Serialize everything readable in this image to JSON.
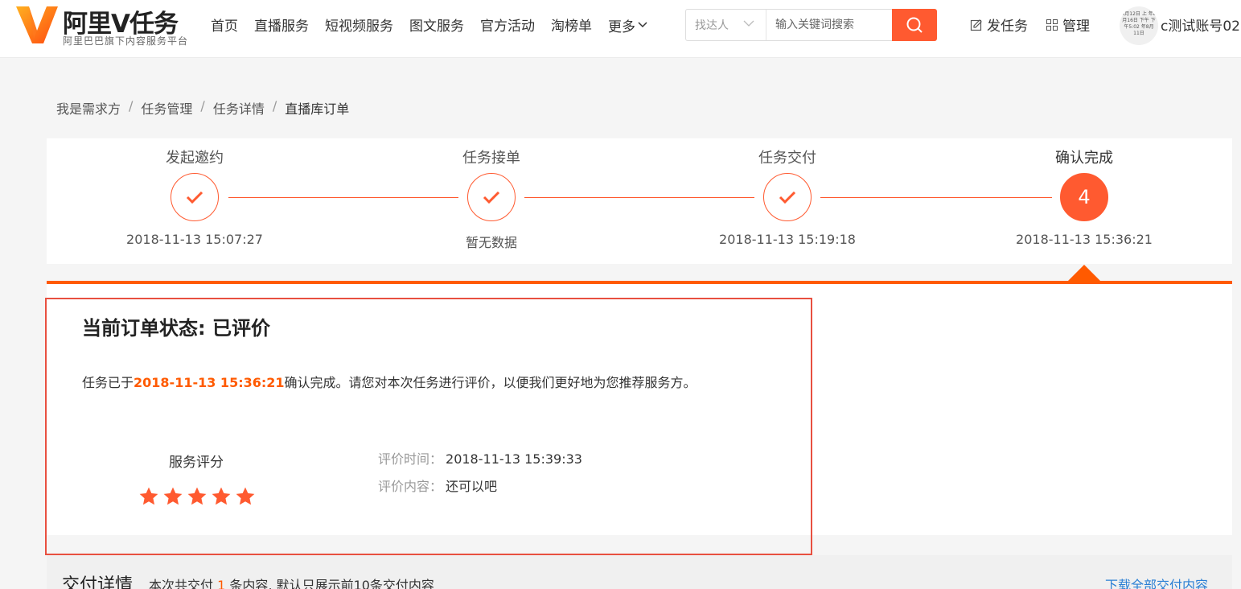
{
  "brand": {
    "title": "阿里V任务",
    "subtitle": "阿里巴巴旗下内容服务平台",
    "accent_color": "#ff5a30"
  },
  "nav": {
    "items": [
      "首页",
      "直播服务",
      "短视频服务",
      "图文服务",
      "官方活动",
      "淘榜单"
    ],
    "more": "更多"
  },
  "search": {
    "select_value": "找达人",
    "placeholder": "输入关键词搜索"
  },
  "header_actions": {
    "publish": "发任务",
    "manage": "管理",
    "avatar_text": "4月12日 上 年8月16日 下午 下午5:02 年8月11日",
    "username": "c测试账号02"
  },
  "breadcrumb": [
    "我是需求方",
    "任务管理",
    "任务详情",
    "直播库订单"
  ],
  "steps": [
    {
      "label": "发起邀约",
      "time": "2018-11-13 15:07:27",
      "done": true
    },
    {
      "label": "任务接单",
      "time": "暂无数据",
      "done": true
    },
    {
      "label": "任务交付",
      "time": "2018-11-13 15:19:18",
      "done": true
    },
    {
      "label": "确认完成",
      "time": "2018-11-13 15:36:21",
      "number": "4",
      "done": false
    }
  ],
  "order": {
    "status_title": "当前订单状态: 已评价",
    "desc_prefix": "任务已于",
    "desc_time": "2018-11-13 15:36:21",
    "desc_suffix": "确认完成。请您对本次任务进行评价，以便我们更好地为您推荐服务方。",
    "rating_label": "服务评分",
    "rating": 5,
    "rating_max": 5,
    "review_time_label": "评价时间：",
    "review_time": "2018-11-13 15:39:33",
    "review_content_label": "评价内容：",
    "review_content": "还可以吧"
  },
  "delivery": {
    "title": "交付详情",
    "desc_prefix": "本次共交付",
    "count": "1",
    "desc_suffix": "条内容, 默认只展示前10条交付内容",
    "download_link": "下载全部交付内容"
  }
}
